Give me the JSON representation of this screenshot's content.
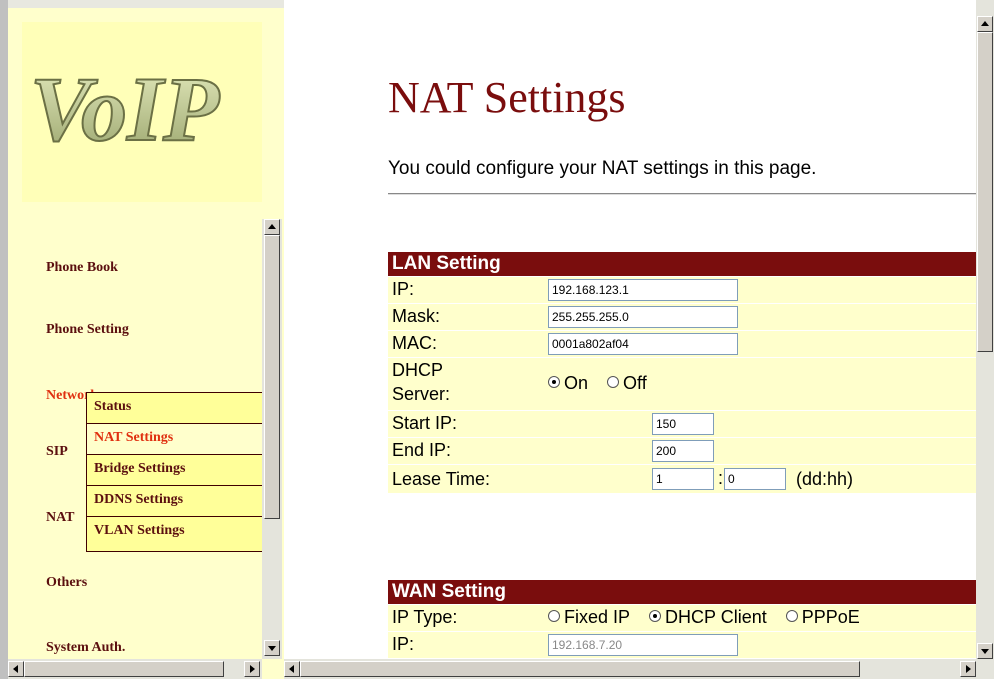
{
  "logo": {
    "text": "VoIP"
  },
  "nav": {
    "items": [
      {
        "label": "Phone Book",
        "has_submenu": true
      },
      {
        "label": "Phone Setting",
        "has_submenu": true
      },
      {
        "label": "Network",
        "has_submenu": true
      },
      {
        "label": "SIP",
        "has_submenu": true
      },
      {
        "label": "NAT",
        "has_submenu": true
      },
      {
        "label": "Others",
        "has_submenu": true
      },
      {
        "label": "System Auth.",
        "has_submenu": false
      }
    ],
    "submenu": [
      {
        "label": "Status"
      },
      {
        "label": "NAT Settings"
      },
      {
        "label": "Bridge Settings"
      },
      {
        "label": "DDNS Settings"
      },
      {
        "label": "VLAN Settings"
      }
    ]
  },
  "page": {
    "title": "NAT Settings",
    "intro": "You could configure your NAT settings in this page."
  },
  "lan": {
    "heading": "LAN Setting",
    "ip_label": "IP:",
    "ip": "192.168.123.1",
    "mask_label": "Mask:",
    "mask": "255.255.255.0",
    "mac_label": "MAC:",
    "mac": "0001a802af04",
    "dhcp_label_1": "DHCP",
    "dhcp_label_2": "Server:",
    "dhcp_on": "On",
    "dhcp_off": "Off",
    "start_ip_label": "Start IP:",
    "start_ip": "150",
    "end_ip_label": "End IP:",
    "end_ip": "200",
    "lease_label": "Lease Time:",
    "lease_dd": "1",
    "lease_hh": "0",
    "lease_sep": ":",
    "lease_unit": "(dd:hh)"
  },
  "wan": {
    "heading": "WAN Setting",
    "ip_type_label": "IP Type:",
    "opt_fixed": "Fixed IP",
    "opt_dhcp": "DHCP Client",
    "opt_pppoe": "PPPoE",
    "ip_label": "IP:",
    "ip": "192.168.7.20"
  },
  "colors": {
    "accent": "#7a0d0d",
    "menu_bg": "#ffffcc",
    "active": "#e03010"
  }
}
